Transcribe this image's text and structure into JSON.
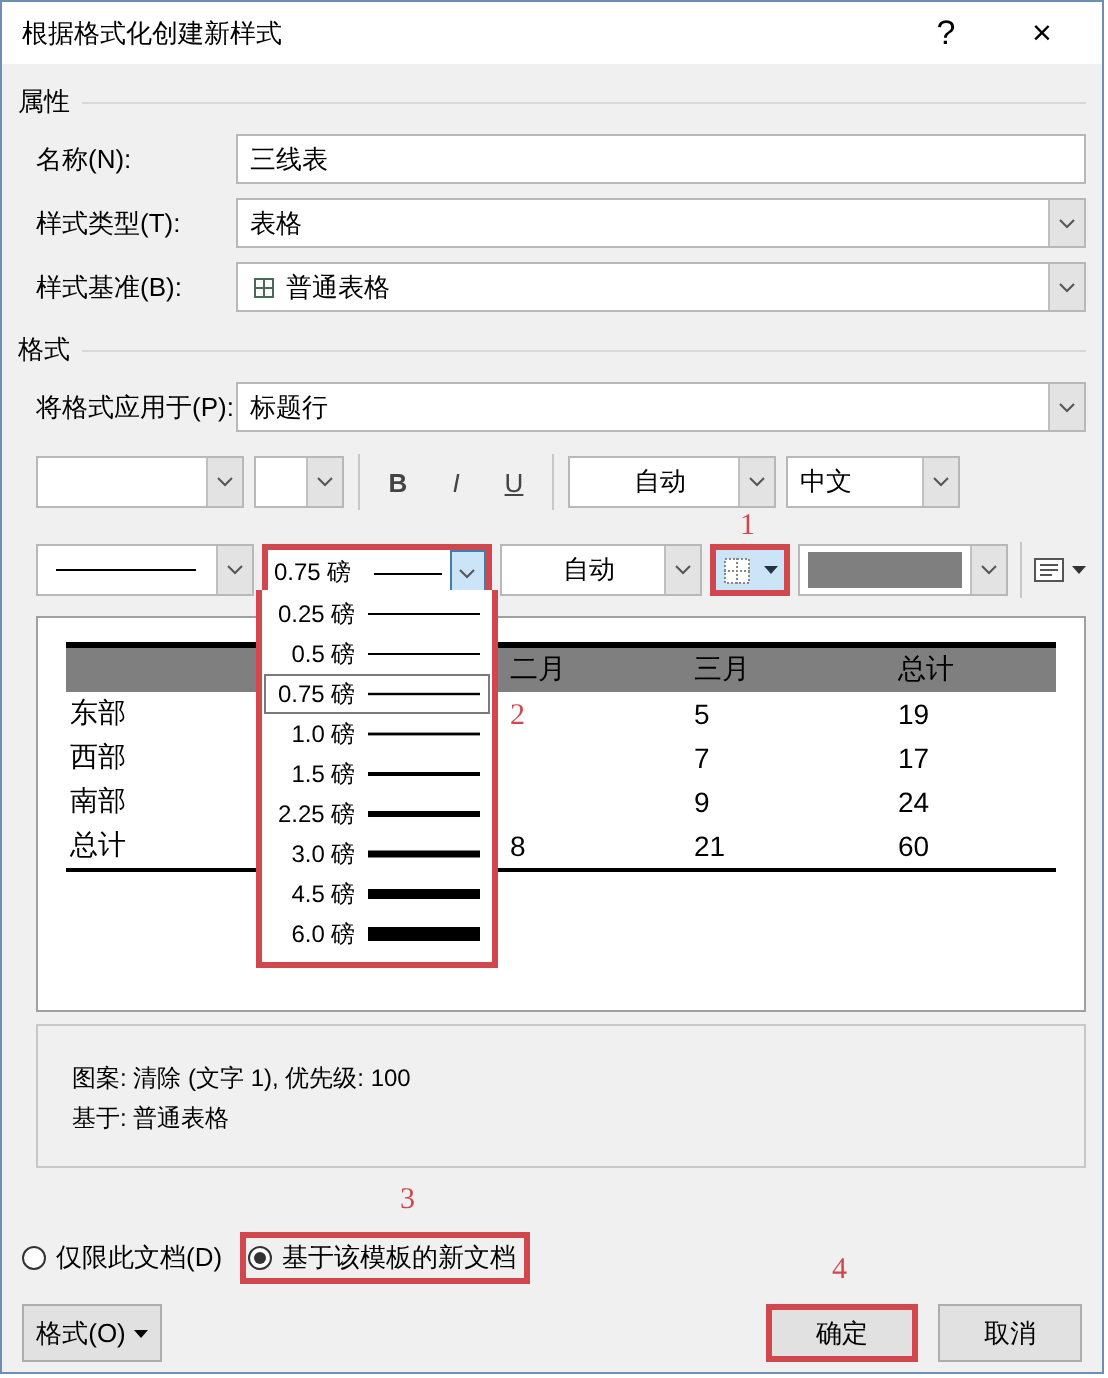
{
  "window": {
    "title": "根据格式化创建新样式",
    "help": "?",
    "close": "×"
  },
  "properties": {
    "heading": "属性",
    "fields": [
      {
        "label": "名称(N):",
        "kind": "text",
        "value": "三线表"
      },
      {
        "label": "样式类型(T):",
        "kind": "select",
        "value": "表格"
      },
      {
        "label": "样式基准(B):",
        "kind": "select-table",
        "value": "普通表格"
      }
    ]
  },
  "format": {
    "heading": "格式",
    "apply_to": {
      "label": "将格式应用于(P):",
      "value": "标题行"
    },
    "font_toolbar": {
      "bold": "B",
      "italic": "I",
      "underline": "U",
      "font_color": "自动",
      "language": "中文"
    },
    "border_toolbar": {
      "line_width": {
        "value": "0.75 磅",
        "open": true,
        "highlighted": true,
        "annotation": "2",
        "options": [
          {
            "label": "0.25 磅",
            "selected": false
          },
          {
            "label": "0.5 磅",
            "selected": false
          },
          {
            "label": "0.75 磅",
            "selected": true
          },
          {
            "label": "1.0 磅",
            "selected": false
          },
          {
            "label": "1.5 磅",
            "selected": false
          },
          {
            "label": "2.25 磅",
            "selected": false
          },
          {
            "label": "3.0 磅",
            "selected": false
          },
          {
            "label": "4.5 磅",
            "selected": false
          },
          {
            "label": "6.0 磅",
            "selected": false
          }
        ]
      },
      "border_color": "自动",
      "border_button": {
        "highlighted": true,
        "annotation": "1"
      }
    }
  },
  "preview": {
    "columns": [
      null,
      null,
      "二月",
      "三月",
      "总计"
    ],
    "rows": [
      [
        "东部",
        null,
        null,
        "5",
        "19"
      ],
      [
        "西部",
        null,
        null,
        "7",
        "17"
      ],
      [
        "南部",
        null,
        null,
        "9",
        "24"
      ],
      [
        "总计",
        null,
        "8",
        "21",
        "60"
      ]
    ]
  },
  "description": [
    "图案: 清除 (文字 1), 优先级: 100",
    "基于: 普通表格"
  ],
  "scope": [
    {
      "label": "仅限此文档(D)",
      "selected": false,
      "highlighted": false
    },
    {
      "label": "基于该模板的新文档",
      "selected": true,
      "highlighted": true,
      "annotation": "3"
    }
  ],
  "buttons": {
    "format": "格式(O)",
    "ok": {
      "label": "确定",
      "highlighted": true,
      "annotation": "4"
    },
    "cancel": "取消"
  }
}
